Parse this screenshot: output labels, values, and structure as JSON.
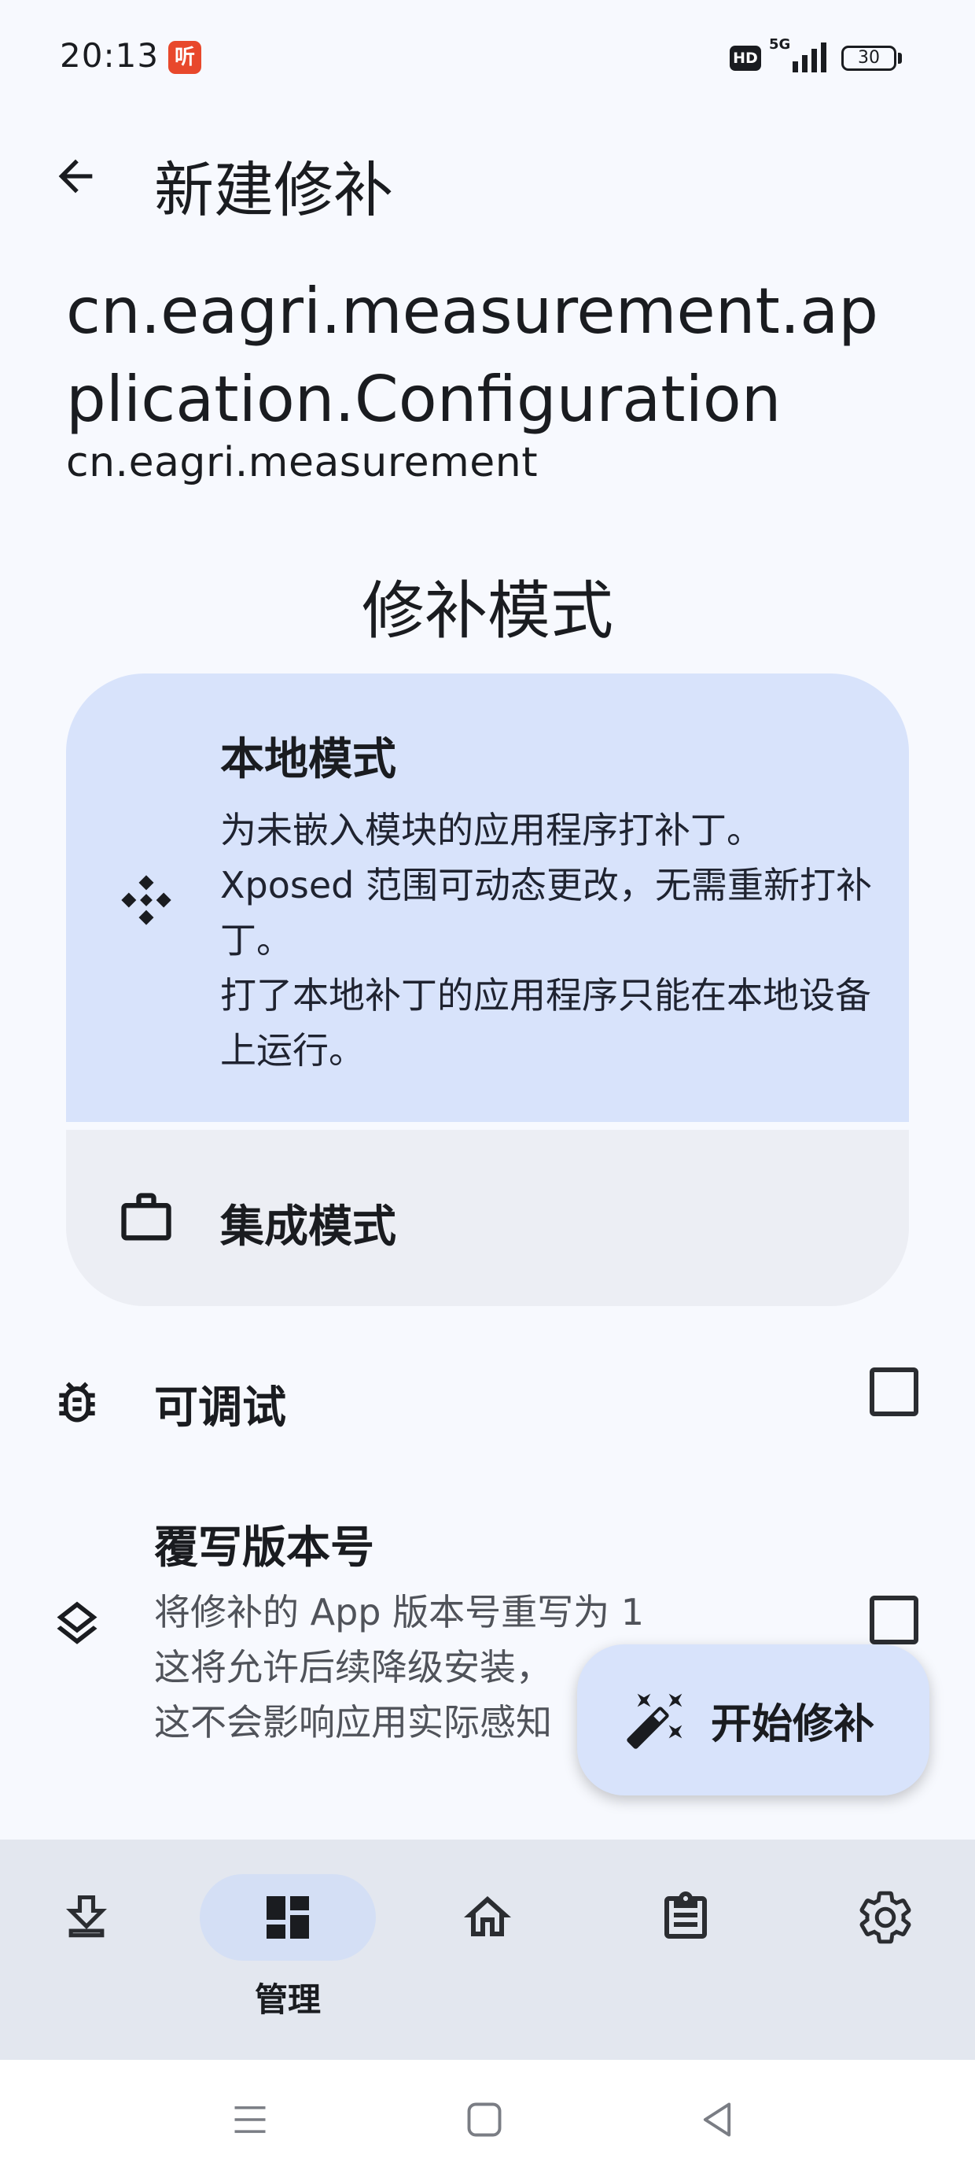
{
  "status_bar": {
    "time": "20:13",
    "notification_badge": "听",
    "hd_label": "HD",
    "network_label": "5G",
    "battery": "30"
  },
  "header": {
    "back_icon": "arrow-left-icon",
    "title": "新建修补"
  },
  "app": {
    "component": "cn.eagri.measurement.application.Configuration",
    "package": "cn.eagri.measurement"
  },
  "patch_mode": {
    "section_title": "修补模式",
    "local": {
      "icon": "diamond-dots-icon",
      "title": "本地模式",
      "description": "为未嵌入模块的应用程序打补丁。\nXposed 范围可动态更改，无需重新打补丁。\n打了本地补丁的应用程序只能在本地设备上运行。",
      "selected": true
    },
    "integrated": {
      "icon": "briefcase-icon",
      "title": "集成模式",
      "selected": false
    }
  },
  "options": {
    "debuggable": {
      "icon": "bug-icon",
      "title": "可调试",
      "checked": false
    },
    "override_version": {
      "icon": "layers-icon",
      "title": "覆写版本号",
      "description": "将修补的 App 版本号重写为 1\n这将允许后续降级安装，\n这不会影响应用实际感知",
      "checked": false
    }
  },
  "fab": {
    "icon": "magic-wand-icon",
    "label": "开始修补"
  },
  "bottom_nav": {
    "items": [
      {
        "icon": "download-icon",
        "label": ""
      },
      {
        "icon": "dashboard-icon",
        "label": "管理",
        "active": true
      },
      {
        "icon": "home-icon",
        "label": ""
      },
      {
        "icon": "clipboard-icon",
        "label": ""
      },
      {
        "icon": "gear-icon",
        "label": ""
      }
    ]
  },
  "colors": {
    "background": "#f7f9fe",
    "selected_card": "#d8e3fb",
    "unselected_card": "#eceef4",
    "nav_bar": "#e3e7ef"
  }
}
